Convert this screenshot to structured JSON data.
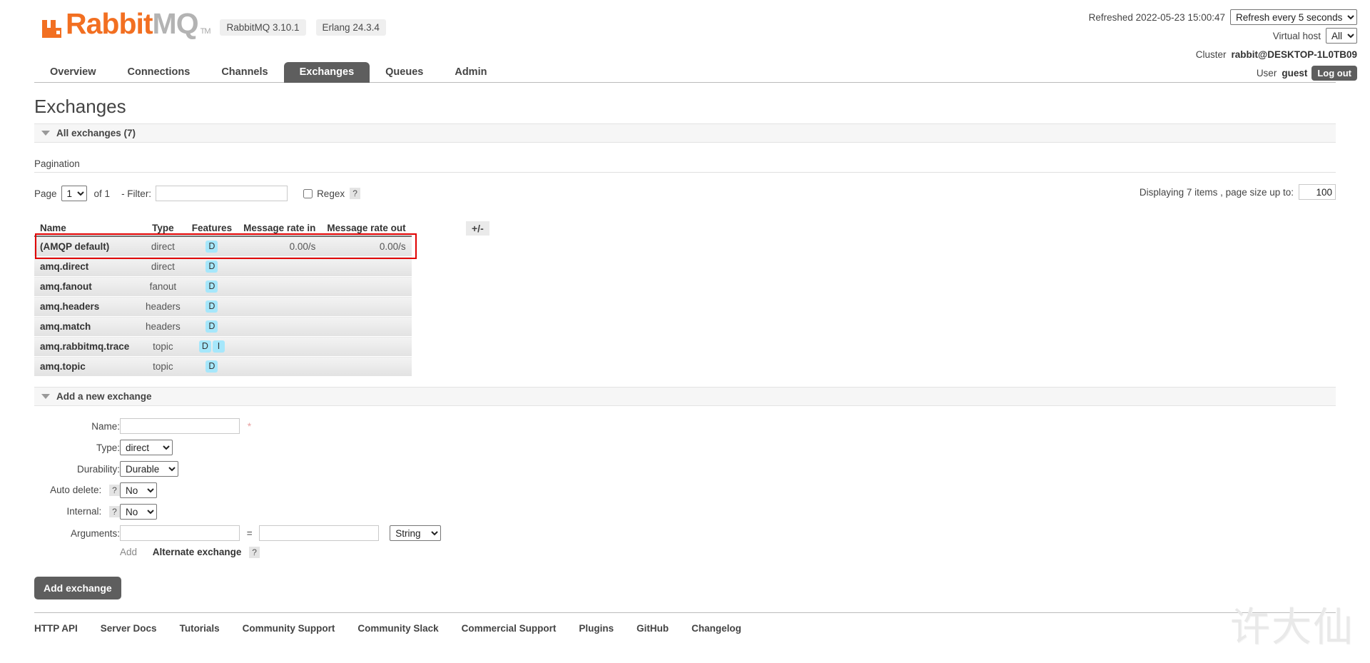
{
  "brand": {
    "name_part1": "Rabbit",
    "name_part2": "MQ",
    "tm": "TM",
    "version_rabbitmq": "RabbitMQ 3.10.1",
    "version_erlang": "Erlang 24.3.4"
  },
  "header": {
    "refreshed_text": "Refreshed 2022-05-23 15:00:47",
    "refresh_interval": "Refresh every 5 seconds",
    "vhost_label": "Virtual host",
    "vhost_value": "All",
    "cluster_label": "Cluster",
    "cluster_value": "rabbit@DESKTOP-1L0TB09",
    "user_label": "User",
    "user_value": "guest",
    "logout_label": "Log out"
  },
  "nav": {
    "items": [
      {
        "label": "Overview",
        "active": false
      },
      {
        "label": "Connections",
        "active": false
      },
      {
        "label": "Channels",
        "active": false
      },
      {
        "label": "Exchanges",
        "active": true
      },
      {
        "label": "Queues",
        "active": false
      },
      {
        "label": "Admin",
        "active": false
      }
    ]
  },
  "page": {
    "title": "Exchanges",
    "all_exchanges_label": "All exchanges (7)"
  },
  "pagination": {
    "section_label": "Pagination",
    "page_label": "Page",
    "page_value": "1",
    "of_label": "of 1",
    "filter_label": "- Filter:",
    "filter_value": "",
    "regex_label": "Regex",
    "help_mark": "?",
    "displaying_text": "Displaying 7 items , page size up to:",
    "page_size_value": "100"
  },
  "table": {
    "columns": [
      "Name",
      "Type",
      "Features",
      "Message rate in",
      "Message rate out"
    ],
    "toggle_label": "+/-",
    "rows": [
      {
        "name": "(AMQP default)",
        "type": "direct",
        "features": [
          "D"
        ],
        "rate_in": "0.00/s",
        "rate_out": "0.00/s",
        "highlighted": true
      },
      {
        "name": "amq.direct",
        "type": "direct",
        "features": [
          "D"
        ],
        "rate_in": "",
        "rate_out": ""
      },
      {
        "name": "amq.fanout",
        "type": "fanout",
        "features": [
          "D"
        ],
        "rate_in": "",
        "rate_out": ""
      },
      {
        "name": "amq.headers",
        "type": "headers",
        "features": [
          "D"
        ],
        "rate_in": "",
        "rate_out": ""
      },
      {
        "name": "amq.match",
        "type": "headers",
        "features": [
          "D"
        ],
        "rate_in": "",
        "rate_out": ""
      },
      {
        "name": "amq.rabbitmq.trace",
        "type": "topic",
        "features": [
          "D",
          "I"
        ],
        "rate_in": "",
        "rate_out": ""
      },
      {
        "name": "amq.topic",
        "type": "topic",
        "features": [
          "D"
        ],
        "rate_in": "",
        "rate_out": ""
      }
    ]
  },
  "form": {
    "section_label": "Add a new exchange",
    "name_label": "Name:",
    "name_value": "",
    "required_mark": "*",
    "type_label": "Type:",
    "type_value": "direct",
    "durability_label": "Durability:",
    "durability_value": "Durable",
    "autodelete_label": "Auto delete:",
    "autodelete_value": "No",
    "internal_label": "Internal:",
    "internal_value": "No",
    "arguments_label": "Arguments:",
    "argument_key": "",
    "argument_equals": "=",
    "argument_value": "",
    "argument_type": "String",
    "add_label": "Add",
    "alternate_exchange_label": "Alternate exchange",
    "help_mark": "?",
    "submit_label": "Add exchange"
  },
  "footer": {
    "links": [
      "HTTP API",
      "Server Docs",
      "Tutorials",
      "Community Support",
      "Community Slack",
      "Commercial Support",
      "Plugins",
      "GitHub",
      "Changelog"
    ]
  },
  "watermark": {
    "text": "许大仙"
  }
}
